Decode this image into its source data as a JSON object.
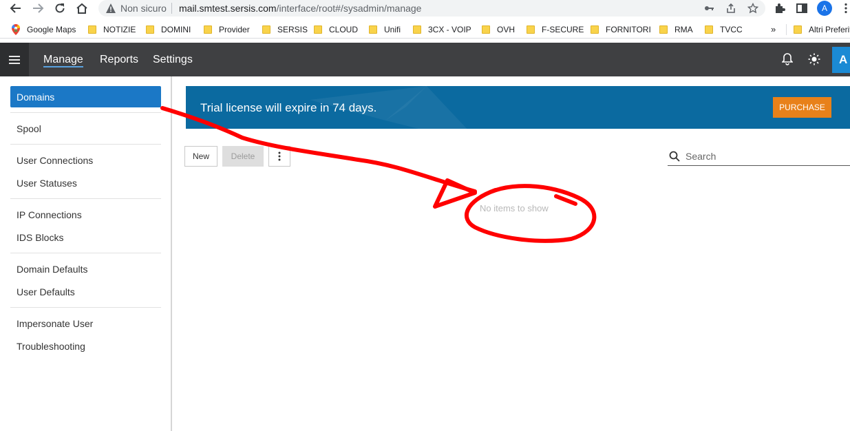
{
  "browser": {
    "security_label": "Non sicuro",
    "url_host": "mail.smtest.sersis.com",
    "url_path": "/interface/root#/sysadmin/manage",
    "profile_initial": "A"
  },
  "bookmarks": [
    {
      "label": "Google Maps",
      "icon": "maps-pin-icon"
    },
    {
      "label": "NOTIZIE",
      "icon": "folder-icon"
    },
    {
      "label": "DOMINI",
      "icon": "folder-icon"
    },
    {
      "label": "Provider",
      "icon": "folder-icon"
    },
    {
      "label": "SERSIS",
      "icon": "folder-icon"
    },
    {
      "label": "CLOUD",
      "icon": "folder-icon"
    },
    {
      "label": "Unifi",
      "icon": "folder-icon"
    },
    {
      "label": "3CX - VOIP",
      "icon": "folder-icon"
    },
    {
      "label": "OVH",
      "icon": "folder-icon"
    },
    {
      "label": "F-SECURE",
      "icon": "folder-icon"
    },
    {
      "label": "FORNITORI",
      "icon": "folder-icon"
    },
    {
      "label": "RMA",
      "icon": "folder-icon"
    },
    {
      "label": "TVCC",
      "icon": "folder-icon"
    }
  ],
  "bookmarks_overflow": "»",
  "bookmarks_other": "Altri Preferiti",
  "header": {
    "nav": [
      "Manage",
      "Reports",
      "Settings"
    ],
    "active_nav": "Manage",
    "user_initial": "A"
  },
  "sidebar": {
    "items": [
      "Domains",
      "Spool",
      "User Connections",
      "User Statuses",
      "IP Connections",
      "IDS Blocks",
      "Domain Defaults",
      "User Defaults",
      "Impersonate User",
      "Troubleshooting"
    ],
    "active": "Domains"
  },
  "banner": {
    "message": "Trial license will expire in 74 days.",
    "button": "PURCHASE"
  },
  "toolbar": {
    "new_label": "New",
    "delete_label": "Delete",
    "more_icon": "vertical-dots-icon"
  },
  "search": {
    "placeholder": "Search"
  },
  "list": {
    "empty_message": "No items to show"
  },
  "colors": {
    "header_bg": "#3f4042",
    "sidebar_active": "#1b78c6",
    "banner_bg": "#0b6aa0",
    "purchase_bg": "#e8811a",
    "annotation_red": "#ff0000"
  }
}
